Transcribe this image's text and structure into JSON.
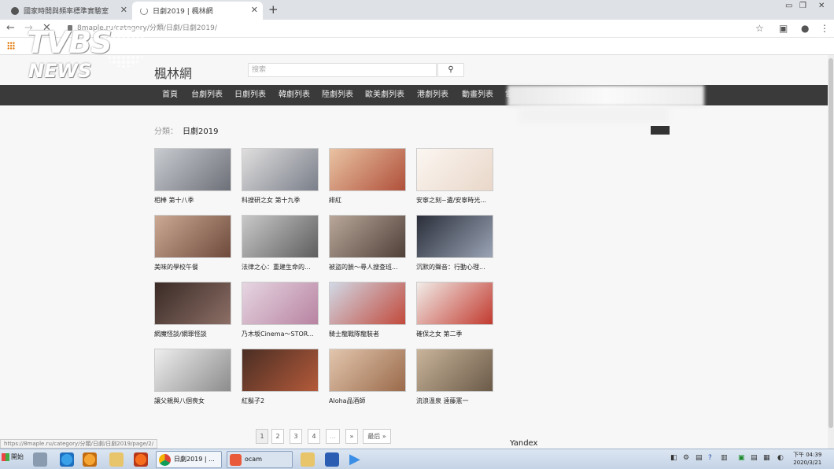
{
  "browser": {
    "tabs": [
      {
        "title": "國家時間與頻率標準實驗室"
      },
      {
        "title": "日劇2019 | 楓林網"
      }
    ],
    "new_tab": "+",
    "url": "8maple.ru/category/分類/日劇/日劇2019/",
    "status_url": "https://8maple.ru/category/分類/日劇/日劇2019/page/2/"
  },
  "watermark": {
    "line1": "TVBS",
    "line2": "NEWS"
  },
  "site": {
    "logo": "楓林網",
    "search_placeholder": "搜索",
    "nav": [
      "首頁",
      "台劇列表",
      "日劇列表",
      "韓劇列表",
      "陸劇列表",
      "歐美劇列表",
      "港劇列表",
      "動畫列表",
      "電"
    ],
    "breadcrumb_label": "分類：",
    "breadcrumb_value": "日劇2019",
    "items": [
      {
        "title": "相棒 第十八季",
        "colors": [
          "#c8cbd0",
          "#6d7078"
        ]
      },
      {
        "title": "科搜研之女 第十九季",
        "colors": [
          "#e0dede",
          "#7a7f8a"
        ]
      },
      {
        "title": "緋紅",
        "colors": [
          "#e9c3a3",
          "#b0503a"
        ]
      },
      {
        "title": "安寧之刻~遺/安寧時光...",
        "colors": [
          "#fbf6f1",
          "#e9d7c9"
        ]
      },
      {
        "title": "美味的學校午餐",
        "colors": [
          "#cba993",
          "#6e4a3c"
        ]
      },
      {
        "title": "法律之心：重建生命的...",
        "colors": [
          "#c9c9c9",
          "#5e5e5e"
        ]
      },
      {
        "title": "被盜的臉～尋人搜查班...",
        "colors": [
          "#b9a79a",
          "#4f4038"
        ]
      },
      {
        "title": "沉默的聲音：行動心理...",
        "colors": [
          "#2a2e3a",
          "#9aa4b5"
        ]
      },
      {
        "title": "網魔怪談/網罪怪談",
        "colors": [
          "#3a2a26",
          "#8c6f66"
        ]
      },
      {
        "title": "乃木坂Cinema～STOR...",
        "colors": [
          "#e6d6e2",
          "#b883a1"
        ]
      },
      {
        "title": "騎士龍戰隊龍裝者",
        "colors": [
          "#d1d9e6",
          "#c24a3c"
        ]
      },
      {
        "title": "確保之女 第二季",
        "colors": [
          "#f1ece8",
          "#c23a2f"
        ]
      },
      {
        "title": "讓父親與八個喪女",
        "colors": [
          "#eeeeee",
          "#8c8c8c"
        ]
      },
      {
        "title": "紅鬍子2",
        "colors": [
          "#4a2e24",
          "#b45a3a"
        ]
      },
      {
        "title": "Aloha品酒師",
        "colors": [
          "#e2c6ae",
          "#9a6a4a"
        ]
      },
      {
        "title": "流浪溫泉 遠藤憲一",
        "colors": [
          "#c9b49a",
          "#6a5a48"
        ]
      }
    ],
    "pagination": [
      "1",
      "2",
      "3",
      "4",
      "...",
      "»",
      "最后 »"
    ],
    "yandex": "Yandex"
  },
  "taskbar": {
    "start": "開始",
    "tasks": [
      "日劇2019 | ...",
      "ocam"
    ],
    "clock_time": "下午 04:39",
    "clock_date": "2020/3/21"
  }
}
